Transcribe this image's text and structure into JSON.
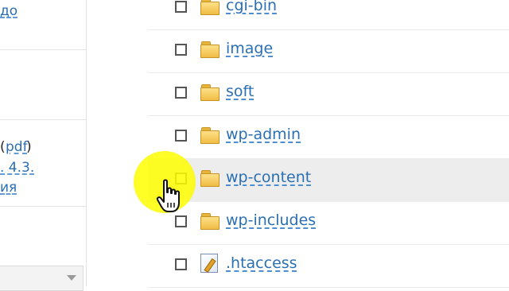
{
  "sidebar": {
    "block1": {
      "line1": "до"
    },
    "block2": {
      "line1_suffix": "(",
      "line1_link": "pdf",
      "line1_close": ")",
      "line2": ". 4.3.",
      "line3": "ия"
    }
  },
  "files": [
    {
      "name": "cgi-bin",
      "type": "folder",
      "icon": "folder-icon",
      "checked": false
    },
    {
      "name": "image",
      "type": "folder",
      "icon": "folder-icon",
      "checked": false
    },
    {
      "name": "soft",
      "type": "folder",
      "icon": "folder-icon",
      "checked": false
    },
    {
      "name": "wp-admin",
      "type": "folder",
      "icon": "folder-icon",
      "checked": false
    },
    {
      "name": "wp-content",
      "type": "folder",
      "icon": "folder-icon",
      "checked": false,
      "highlighted": true
    },
    {
      "name": "wp-includes",
      "type": "folder",
      "icon": "folder-icon",
      "checked": false
    },
    {
      "name": ".htaccess",
      "type": "file",
      "icon": "edit-file-icon",
      "checked": false
    }
  ],
  "colors": {
    "link": "#2b6fb3",
    "folder": "#f0bd45",
    "row_highlight": "#ededed",
    "mouse_highlight": "#ffff00"
  }
}
